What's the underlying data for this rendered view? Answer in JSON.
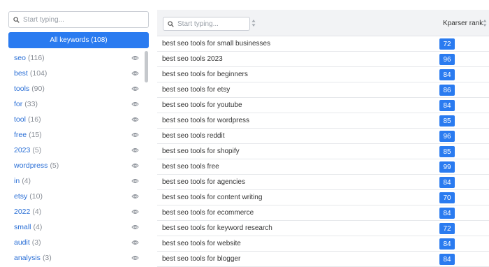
{
  "sidebar": {
    "search_placeholder": "Start typing...",
    "all_keywords_label": "All keywords (108)",
    "keywords": [
      {
        "word": "seo",
        "count": "(116)"
      },
      {
        "word": "best",
        "count": "(104)"
      },
      {
        "word": "tools",
        "count": "(90)"
      },
      {
        "word": "for",
        "count": "(33)"
      },
      {
        "word": "tool",
        "count": "(16)"
      },
      {
        "word": "free",
        "count": "(15)"
      },
      {
        "word": "2023",
        "count": "(5)"
      },
      {
        "word": "wordpress",
        "count": "(5)"
      },
      {
        "word": "in",
        "count": "(4)"
      },
      {
        "word": "etsy",
        "count": "(10)"
      },
      {
        "word": "2022",
        "count": "(4)"
      },
      {
        "word": "small",
        "count": "(4)"
      },
      {
        "word": "audit",
        "count": "(3)"
      },
      {
        "word": "analysis",
        "count": "(3)"
      }
    ]
  },
  "table": {
    "search_placeholder": "Start typing...",
    "rank_header": "Kparser rank",
    "rows": [
      {
        "keyword": "best seo tools for small businesses",
        "rank": "72"
      },
      {
        "keyword": "best seo tools 2023",
        "rank": "96"
      },
      {
        "keyword": "best seo tools for beginners",
        "rank": "84"
      },
      {
        "keyword": "best seo tools for etsy",
        "rank": "86"
      },
      {
        "keyword": "best seo tools for youtube",
        "rank": "84"
      },
      {
        "keyword": "best seo tools for wordpress",
        "rank": "85"
      },
      {
        "keyword": "best seo tools reddit",
        "rank": "96"
      },
      {
        "keyword": "best seo tools for shopify",
        "rank": "85"
      },
      {
        "keyword": "best seo tools free",
        "rank": "99"
      },
      {
        "keyword": "best seo tools for agencies",
        "rank": "84"
      },
      {
        "keyword": "best seo tools for content writing",
        "rank": "70"
      },
      {
        "keyword": "best seo tools for ecommerce",
        "rank": "84"
      },
      {
        "keyword": "best seo tools for keyword research",
        "rank": "72"
      },
      {
        "keyword": "best seo tools for website",
        "rank": "84"
      },
      {
        "keyword": "best seo tools for blogger",
        "rank": "84"
      }
    ]
  },
  "icons": {
    "search": "search-icon",
    "visibility": "eye-icon",
    "sort": "sort-icon"
  },
  "colors": {
    "accent": "#2a7bf0",
    "link": "#2a6fd6",
    "header_bg": "#f2f3f5"
  }
}
